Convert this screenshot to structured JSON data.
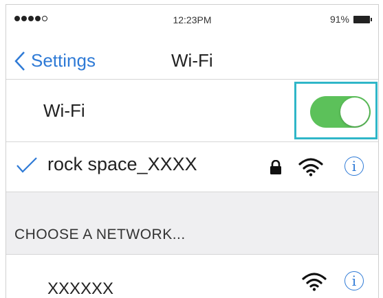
{
  "status_bar": {
    "time": "12:23PM",
    "battery": "91%",
    "signal_bars_filled": 4,
    "signal_bars_total": 5
  },
  "nav": {
    "back_label": "Settings",
    "title": "Wi-Fi"
  },
  "wifi_toggle": {
    "label": "Wi-Fi",
    "state": "on",
    "on_color": "#5cc15a",
    "highlight_color": "#2fb6c8"
  },
  "connected_network": {
    "name": "rock space_XXXX",
    "secured": true,
    "info_glyph": "i"
  },
  "section": {
    "header": "CHOOSE A NETWORK..."
  },
  "networks": [
    {
      "name": "XXXXXX",
      "info_glyph": "i"
    }
  ],
  "colors": {
    "accent": "#2e7ad6",
    "separator": "#d6d6d6",
    "section_bg": "#efeff1"
  }
}
